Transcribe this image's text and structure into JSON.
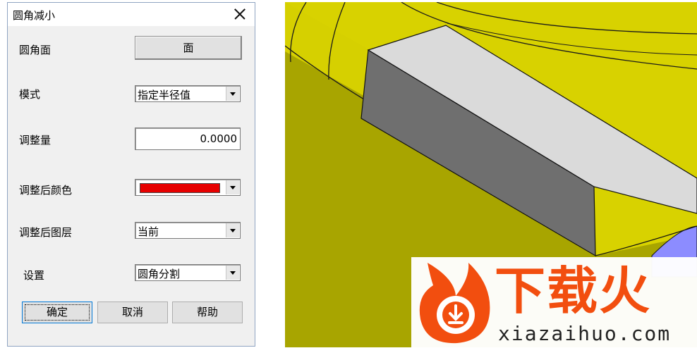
{
  "dialog": {
    "title": "圆角减小",
    "fields": {
      "face_label": "圆角面",
      "face_button": "面",
      "mode_label": "模式",
      "mode_value": "指定半径值",
      "amount_label": "调整量",
      "amount_value": "0.0000",
      "color_label": "调整后颜色",
      "color_value": "#e60000",
      "layer_label": "调整后图层",
      "layer_value": "当前",
      "settings_label": "设置",
      "settings_value": "圆角分割"
    },
    "buttons": {
      "ok": "确定",
      "cancel": "取消",
      "help": "帮助"
    }
  },
  "viewport": {
    "colors": {
      "yellow": "#d8d200",
      "yellow_dark": "#8c8a00",
      "block_top": "#d9d9d9",
      "block_side": "#6e6e6e",
      "purple": "#8c8cff"
    }
  },
  "watermark": {
    "brand": "下载火",
    "url": "xiazaihuo.com",
    "color": "#f24e0f"
  }
}
